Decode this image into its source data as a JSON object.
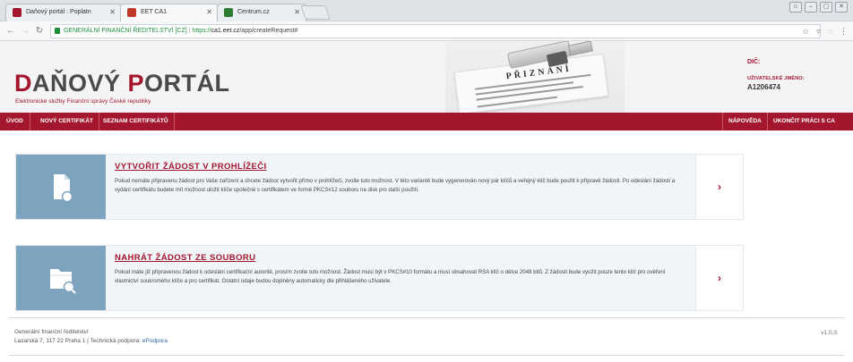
{
  "browser": {
    "tabs": [
      {
        "label": "Daňový portál : Poplatn",
        "favicon_color": "#a3162e"
      },
      {
        "label": "EET CA1",
        "favicon_color": "#c0392b"
      },
      {
        "label": "Centrum.cz",
        "favicon_color": "#2d7d32"
      }
    ],
    "address": {
      "secure_label": "GENERÁLNÍ FINANČNÍ ŘEDITELSTVÍ [CZ]",
      "separator": "|",
      "scheme": "https://",
      "host": "ca1.eet.cz",
      "path": "/app/createRequest#"
    }
  },
  "header": {
    "logo_first": "D",
    "logo_rest1": "AŇOVÝ ",
    "logo_second": "P",
    "logo_rest2": "ORTÁL",
    "subtitle": "Elektronické služby Finanční správy České republiky",
    "banner_title": "PŘIZNÁNÍ",
    "dic_label": "DIČ:",
    "user_label": "UŽIVATELSKÉ JMÉNO:",
    "user_id": "A1206474"
  },
  "nav": {
    "uvod": "ÚVOD",
    "novy": "NOVÝ CERTIFIKÁT",
    "seznam": "SEZNAM CERTIFIKÁTŮ",
    "napoveda": "NÁPOVĚDA",
    "ukoncit": "UKONČIT PRÁCI S CA"
  },
  "cards": [
    {
      "title": "VYTVOŘIT ŽÁDOST V PROHLÍŽEČI",
      "text": "Pokud nemáte připravenu žádost pro Vaše zařízení a chcete žádost vytvořit přímo v prohlížeči, zvolte tuto možnost. V této variantě bude vygenerován nový pár klíčů a veřejný klíč bude použit k přípravě žádosti. Po odeslání žádosti a vydání certifikátu budete mít možnost uložit klíče společně s certifikátem ve formě PKCS#12 souboru na disk pro další použití.",
      "arrow": "›"
    },
    {
      "title": "NAHRÁT ŽÁDOST ZE SOUBORU",
      "text": "Pokud máte již připravenou žádost k odeslání certifikační autoritě, prosím zvolte tuto možnost. Žádost musí být v PKCS#10 formátu a musí obsahovat RSA klíč o délce 2048 bitů. Z žádosti bude využit pouze tento klíč pro ověření vlastnictví soukromého klíče a pro certifikát. Ostatní údaje budou doplněny automaticky dle přihlášeného uživatele.",
      "arrow": "›"
    }
  ],
  "footer": {
    "org": "Generální finanční ředitelství",
    "address": "Lazarská 7, 117 22 Praha 1 | Technická podpora: ",
    "support_link": "ePodpora",
    "version": "v1.0.3"
  }
}
